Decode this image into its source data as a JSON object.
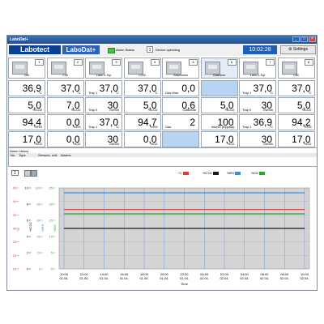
{
  "window": {
    "title": "LaboDat+",
    "minimize": "_",
    "maximize": "□",
    "close": "×"
  },
  "toolbar": {
    "logo": "Labotect",
    "app": "LaboDat+",
    "alarm_status": "Alarm Status",
    "device_number": "1",
    "device_status": "Device operating",
    "clock": "10:02:28",
    "settings": "Settings"
  },
  "chambers": [
    {
      "num": "1",
      "label": "C60"
    },
    {
      "num": "2",
      "label": "C16"
    },
    {
      "num": "3",
      "label": "Labo C-Top"
    },
    {
      "num": "4",
      "label": "C200"
    },
    {
      "num": "5",
      "label": "Gasmonitor"
    },
    {
      "num": "6",
      "label": "Gasmixer"
    },
    {
      "num": "7",
      "label": "Labo C-Top"
    },
    {
      "num": "8",
      "label": "C60"
    }
  ],
  "readings": [
    [
      {
        "v": "36,9",
        "u": "°C",
        "s": ""
      },
      {
        "v": "37,0",
        "u": "°C",
        "s": ""
      },
      {
        "v": "37,0",
        "u": "°C",
        "s": "Tray 1"
      },
      {
        "v": "37,0",
        "u": "°C",
        "s": ""
      },
      {
        "v": "0,0",
        "u": "",
        "s": "Gas l/bar"
      },
      {
        "v": "",
        "u": "",
        "s": ""
      },
      {
        "v": "37,0",
        "u": "°C",
        "s": "Tray 1"
      },
      {
        "v": "37,0",
        "u": "°C",
        "s": ""
      }
    ],
    [
      {
        "v": "5,0",
        "u": "%CO2",
        "s": ""
      },
      {
        "v": "7,0",
        "u": "%CO2",
        "s": ""
      },
      {
        "v": "30",
        "u": "ml/min",
        "s": "Tray 0"
      },
      {
        "v": "5,0",
        "u": "%CO2",
        "s": ""
      },
      {
        "v": "0,6",
        "u": "Gas2/bar",
        "s": ""
      },
      {
        "v": "5,0",
        "u": "%CO2",
        "s": ""
      },
      {
        "v": "30",
        "u": "ml/min",
        "s": "Tray 0"
      },
      {
        "v": "5,0",
        "u": "%CO2",
        "s": ""
      }
    ],
    [
      {
        "v": "94,4",
        "u": "%RH",
        "s": ""
      },
      {
        "v": "0,0",
        "u": "%RH",
        "s": ""
      },
      {
        "v": "37,0",
        "u": "°C",
        "s": "Tray 1"
      },
      {
        "v": "94,7",
        "u": "%RH",
        "s": ""
      },
      {
        "v": "2",
        "u": "",
        "s": "Gas"
      },
      {
        "v": "100",
        "u": "ml/min (Bypass)",
        "s": ""
      },
      {
        "v": "36,9",
        "u": "°C",
        "s": "Tray 1"
      },
      {
        "v": "94,2",
        "u": "%RH",
        "s": ""
      }
    ],
    [
      {
        "v": "17,0",
        "u": "%O2",
        "s": ""
      },
      {
        "v": "0,0",
        "u": "%O2",
        "s": ""
      },
      {
        "v": "30",
        "u": "ml/min",
        "s": ""
      },
      {
        "v": "0,0",
        "u": "%O2",
        "s": ""
      },
      {
        "v": "",
        "u": "",
        "s": ""
      },
      {
        "v": "17,0",
        "u": "%O2",
        "s": ""
      },
      {
        "v": "30",
        "u": "ml/min",
        "s": ""
      },
      {
        "v": "17,0",
        "u": "%O2",
        "s": ""
      }
    ]
  ],
  "alarms": {
    "title": "Alarm history",
    "columns": [
      "No.",
      "Type",
      "Sensors",
      "unit",
      "Alarms"
    ]
  },
  "chart_controls": {
    "chart_number": "1",
    "legend": [
      {
        "label": "°C",
        "color": "#d93a3a"
      },
      {
        "label": "%CO2",
        "color": "#1a1a1a"
      },
      {
        "label": "%RH",
        "color": "#3f8fd8"
      },
      {
        "label": "%O2",
        "color": "#2aa82a"
      }
    ]
  },
  "colors": {
    "temperature": "#d93a3a",
    "co2": "#1a1a1a",
    "humidity": "#3f8fd8",
    "o2": "#2aa82a",
    "readout_highlight": "#b8d4f3",
    "brand_blue": "#0b3f8f"
  },
  "chart_data": {
    "type": "line",
    "xlabel": "Time",
    "ylabel": "",
    "axes": [
      {
        "label": "°C",
        "ticks": [
          "45",
          "40",
          "35",
          "30",
          "25",
          "20",
          "15"
        ],
        "color": "#d93a3a",
        "ylim": [
          15,
          45
        ]
      },
      {
        "label": "%CO2",
        "ticks": [
          "10",
          "8",
          "6",
          "4",
          "2",
          "0"
        ],
        "color": "#1a1a1a",
        "ylim": [
          0,
          10
        ]
      },
      {
        "label": "%RH",
        "ticks": [
          "100",
          "80",
          "60",
          "40",
          "20",
          "0"
        ],
        "color": "#3f8fd8",
        "ylim": [
          0,
          100
        ]
      },
      {
        "label": "%O2",
        "ticks": [
          "25",
          "20",
          "15",
          "10",
          "5",
          "0"
        ],
        "color": "#2aa82a",
        "ylim": [
          0,
          25
        ]
      }
    ],
    "x": [
      "10:00 01.04.",
      "12:00 01.04.",
      "14:00 01.04.",
      "16:00 01.04.",
      "18:00 01.04.",
      "20:00 01.04.",
      "22:00 01.04.",
      "00:00 02.04.",
      "02:00 02.04.",
      "04:00 02.04.",
      "06:00 02.04.",
      "08:00 02.04.",
      "10:00 02.04."
    ],
    "series": [
      {
        "name": "°C",
        "axis": 0,
        "color": "#d93a3a",
        "values": [
          37,
          37,
          37,
          37,
          37,
          37,
          37,
          37,
          37,
          37,
          37,
          37,
          37
        ]
      },
      {
        "name": "%CO2",
        "axis": 1,
        "color": "#1a1a1a",
        "values": [
          5,
          5,
          5,
          5,
          5,
          5,
          5,
          5,
          5,
          5,
          5,
          5,
          5
        ]
      },
      {
        "name": "%RH",
        "axis": 2,
        "color": "#3f8fd8",
        "values": [
          94,
          94,
          94,
          94,
          94,
          94,
          94,
          94,
          94,
          94,
          94,
          94,
          94
        ]
      },
      {
        "name": "%O2",
        "axis": 3,
        "color": "#2aa82a",
        "values": [
          17,
          17,
          17,
          17,
          17,
          17,
          17,
          17,
          17,
          17,
          17,
          17,
          17
        ]
      }
    ]
  }
}
